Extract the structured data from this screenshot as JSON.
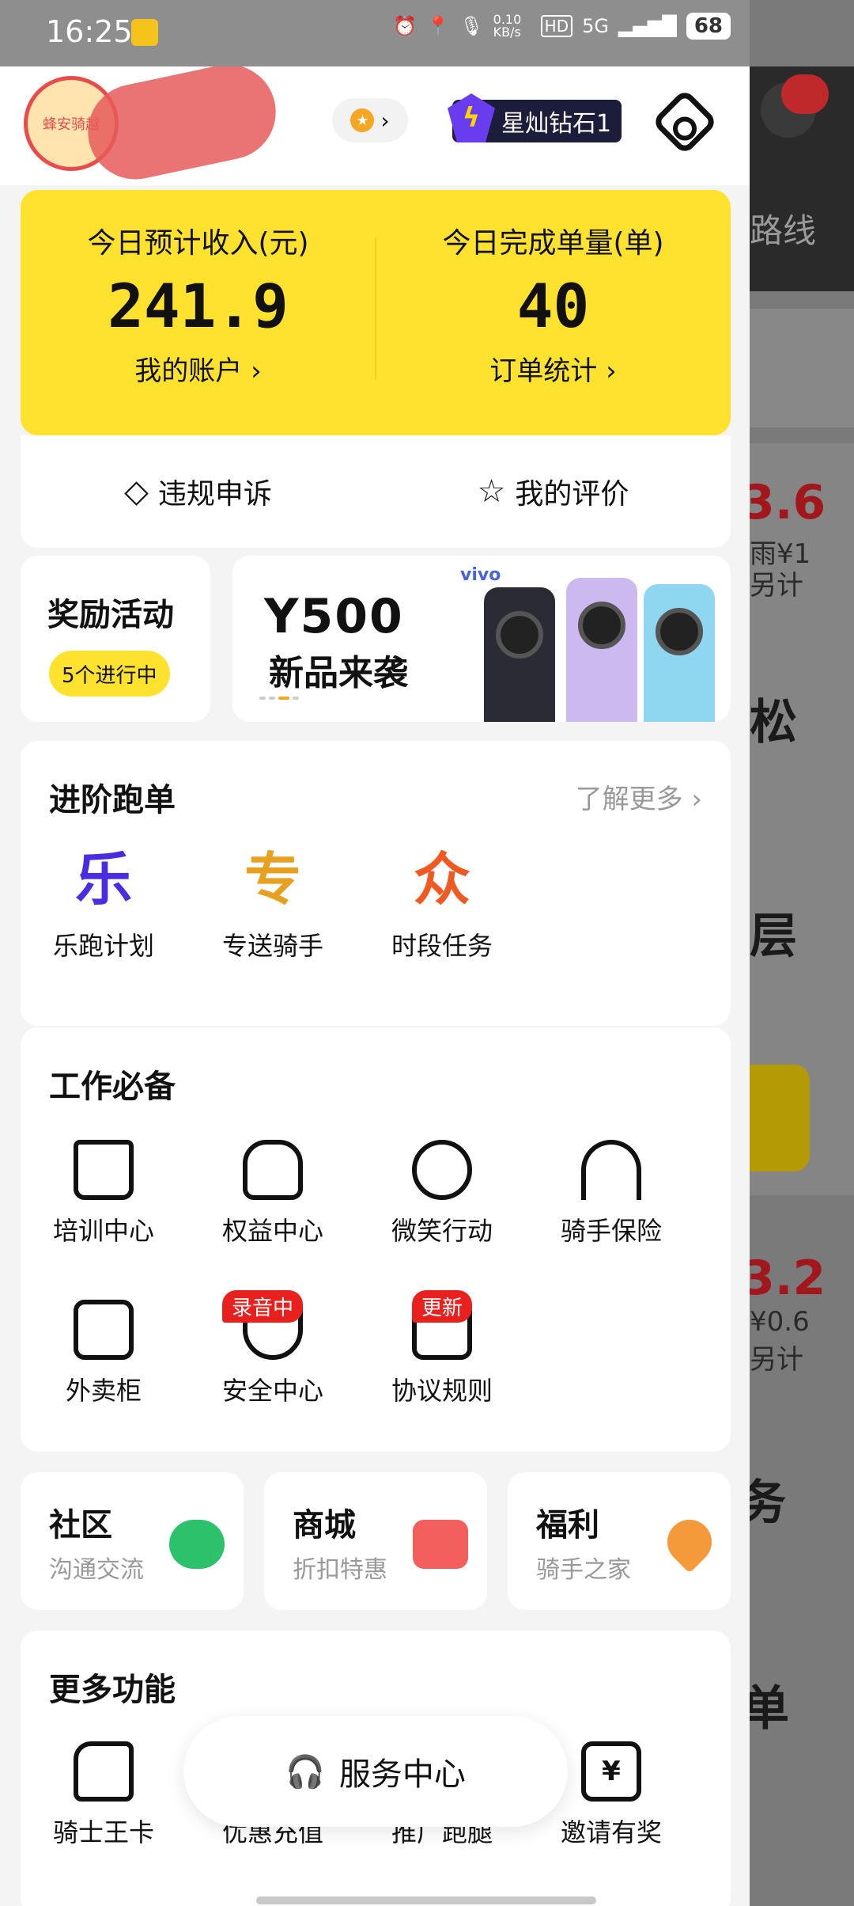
{
  "status_bar": {
    "time": "16:25",
    "net_speed": "0.10 KB/s",
    "hd": "HD",
    "signal": "5G",
    "battery": "68"
  },
  "header": {
    "avatar_text": "蜂安骑越",
    "level_badge": "★",
    "vip_label": "星灿钻石1"
  },
  "summary": {
    "income_label": "今日预计收入(元)",
    "income_value": "241.9",
    "account_link": "我的账户",
    "orders_label": "今日完成单量(单)",
    "orders_value": "40",
    "orders_link": "订单统计"
  },
  "quick_actions": {
    "appeal": "违规申诉",
    "rating": "我的评价"
  },
  "reward": {
    "title": "奖励活动",
    "badge": "5个进行中"
  },
  "banner": {
    "brand": "vivo",
    "title": "Y500",
    "subtitle": "新品来袭"
  },
  "advanced": {
    "title": "进阶跑单",
    "more": "了解更多",
    "items": [
      {
        "char": "乐",
        "label": "乐跑计划",
        "color": "#4a2de0"
      },
      {
        "char": "专",
        "label": "专送骑手",
        "color": "#e8a020"
      },
      {
        "char": "众",
        "label": "时段任务",
        "color": "#f05a22"
      }
    ]
  },
  "work": {
    "title": "工作必备",
    "items": [
      {
        "label": "培训中心",
        "icon": "book-icon"
      },
      {
        "label": "权益中心",
        "icon": "crown-icon"
      },
      {
        "label": "微笑行动",
        "icon": "smile-icon"
      },
      {
        "label": "骑手保险",
        "icon": "umbrella-icon"
      },
      {
        "label": "外卖柜",
        "icon": "locker-icon"
      },
      {
        "label": "安全中心",
        "icon": "shield-icon",
        "tag": "录音中"
      },
      {
        "label": "协议规则",
        "icon": "agreement-icon",
        "tag": "更新"
      }
    ]
  },
  "mini_cards": [
    {
      "title": "社区",
      "sub": "沟通交流",
      "icon": "chat-icon",
      "color": "#2bc26b"
    },
    {
      "title": "商城",
      "sub": "折扣特惠",
      "icon": "gift-icon",
      "color": "#f25f5c"
    },
    {
      "title": "福利",
      "sub": "骑手之家",
      "icon": "heart-icon",
      "color": "#f59a3a"
    }
  ],
  "more": {
    "title": "更多功能",
    "items": [
      {
        "label": "骑士王卡",
        "icon": "sim-card-icon"
      },
      {
        "label": "优惠充值",
        "icon": "recharge-icon"
      },
      {
        "label": "推广跑腿",
        "icon": "errand-icon"
      },
      {
        "label": "邀请有奖",
        "icon": "ticket-icon"
      }
    ]
  },
  "service_center": "服务中心",
  "background_page": {
    "route_text": "路线",
    "text_a": "3.6",
    "text_b": "雨¥1",
    "text_c": "另计",
    "text_d": "松",
    "text_e": "层",
    "text_f": "3.2",
    "text_g": "¥0.6",
    "text_h": "另计",
    "text_i": "务",
    "text_j": "单"
  }
}
